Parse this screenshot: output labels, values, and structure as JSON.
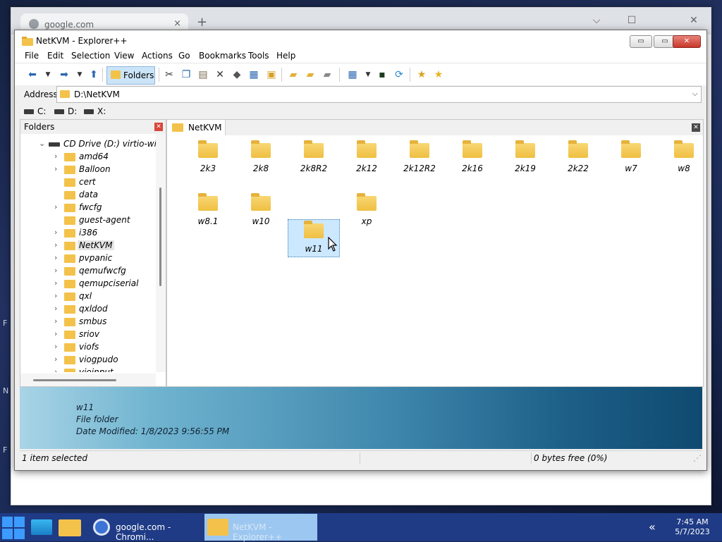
{
  "desktop": {
    "fragments": [
      "F",
      "N",
      "F"
    ]
  },
  "chrome": {
    "tab_title": "google.com",
    "tab_close": "×",
    "new_tab": "+",
    "minimize": "⌵",
    "maximize": "☐",
    "close": "✕"
  },
  "explorer": {
    "title": "NetKVM - Explorer++",
    "window_buttons": {
      "minimize": "▭",
      "maximize": "▭",
      "close": "✕"
    },
    "menu": [
      "File",
      "Edit",
      "Selection",
      "View",
      "Actions",
      "Go",
      "Bookmarks",
      "Tools",
      "Help"
    ],
    "toolbar": {
      "folders_label": "Folders"
    },
    "address": {
      "label": "Address",
      "value": "D:\\NetKVM"
    },
    "drives": [
      "C:",
      "D:",
      "X:"
    ],
    "folders_pane": {
      "header": "Folders",
      "close": "✕",
      "root": "CD Drive (D:) virtio-win",
      "items": [
        "amd64",
        "Balloon",
        "cert",
        "data",
        "fwcfg",
        "guest-agent",
        "i386",
        "NetKVM",
        "pvpanic",
        "qemufwcfg",
        "qemupciserial",
        "qxl",
        "qxldod",
        "smbus",
        "sriov",
        "viofs",
        "viogpudo",
        "vioinput"
      ],
      "selected": "NetKVM"
    },
    "tab": {
      "label": "NetKVM",
      "close": "✕"
    },
    "files": [
      "2k3",
      "2k8",
      "2k8R2",
      "2k12",
      "2k12R2",
      "2k16",
      "2k19",
      "2k22",
      "w7",
      "w8",
      "w8.1",
      "w10",
      "w11",
      "xp"
    ],
    "selected_file": "w11",
    "preview": {
      "name": "w11",
      "type": "File folder",
      "modified": "Date Modified: 1/8/2023 9:56:55 PM"
    },
    "status": {
      "left": "1 item selected",
      "right": "0 bytes free (0%)"
    }
  },
  "taskbar": {
    "chrome_label": "google.com - Chromi...",
    "explorer_label": "NetKVM - Explorer++",
    "chevron": "«",
    "time": "7:45 AM",
    "date": "5/7/2023"
  }
}
